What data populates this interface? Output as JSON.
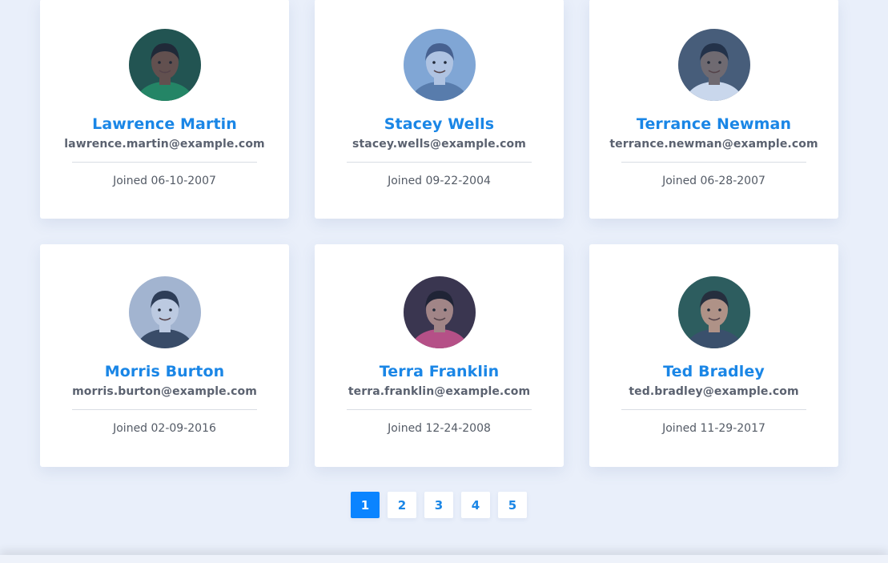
{
  "users": [
    {
      "name": "Lawrence Martin",
      "email": "lawrence.martin@example.com",
      "joined": "Joined 06-10-2007",
      "avatar_colors": {
        "bg": "#1d4f3a",
        "skin": "#6b4a36",
        "shirt": "#1f8a52",
        "hair": "#1a1a1a"
      }
    },
    {
      "name": "Stacey Wells",
      "email": "stacey.wells@example.com",
      "joined": "Joined 09-22-2004",
      "avatar_colors": {
        "bg": "#8fb3d9",
        "skin": "#c9d6ea",
        "shirt": "#5f7fa8",
        "hair": "#4a5f85"
      }
    },
    {
      "name": "Terrance Newman",
      "email": "terrance.newman@example.com",
      "joined": "Joined 06-28-2007",
      "avatar_colors": {
        "bg": "#4a5a6b",
        "skin": "#7a6a60",
        "shirt": "#e8eef6",
        "hair": "#1e2530"
      }
    },
    {
      "name": "Morris Burton",
      "email": "morris.burton@example.com",
      "joined": "Joined 02-09-2016",
      "avatar_colors": {
        "bg": "#b9c4d4",
        "skin": "#d8dee8",
        "shirt": "#394555",
        "hair": "#2a3240"
      }
    },
    {
      "name": "Terra Franklin",
      "email": "terra.franklin@example.com",
      "joined": "Joined 12-24-2008",
      "avatar_colors": {
        "bg": "#3a2a38",
        "skin": "#b88a7a",
        "shirt": "#d04a7a",
        "hair": "#1a1418"
      }
    },
    {
      "name": "Ted Bradley",
      "email": "ted.bradley@example.com",
      "joined": "Joined 11-29-2017",
      "avatar_colors": {
        "bg": "#2a5a4a",
        "skin": "#c89a7a",
        "shirt": "#3a4a5a",
        "hair": "#222222"
      }
    }
  ],
  "pagination": {
    "pages": [
      "1",
      "2",
      "3",
      "4",
      "5"
    ],
    "current": "1"
  },
  "colors": {
    "accent": "#0b84ff",
    "name": "#1a86e6",
    "background": "#e9effa"
  }
}
